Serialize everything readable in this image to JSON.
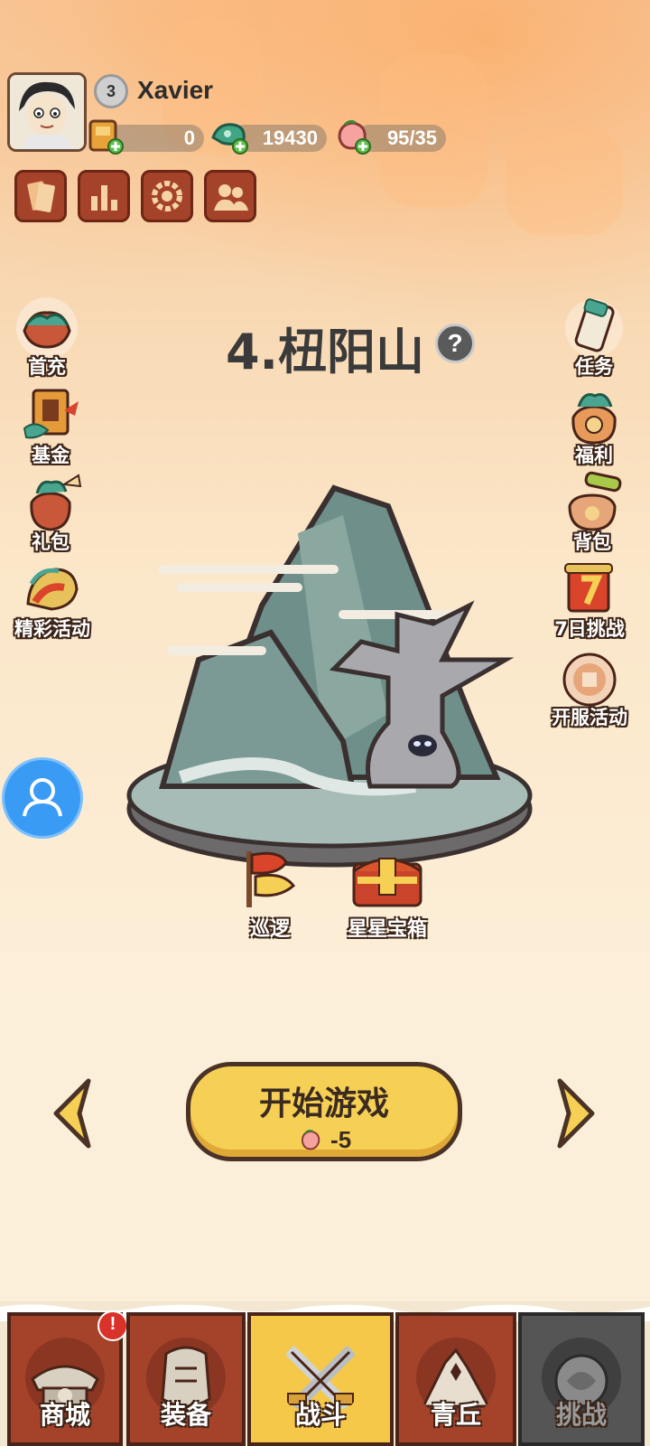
{
  "header": {
    "player_name": "Xavier",
    "level": "3",
    "resources": [
      {
        "name": "ticket",
        "value": "0"
      },
      {
        "name": "jade-coin",
        "value": "19430"
      },
      {
        "name": "peach-stamina",
        "value": "95/35"
      }
    ],
    "tools": [
      "card-icon",
      "rank-icon",
      "settings-icon",
      "friends-icon"
    ]
  },
  "stage": {
    "title": "4.杻阳山",
    "help": "?"
  },
  "left_menu": [
    {
      "label": "首充",
      "icon": "first-recharge-icon"
    },
    {
      "label": "基金",
      "icon": "fund-icon"
    },
    {
      "label": "礼包",
      "icon": "gift-bag-icon"
    },
    {
      "label": "精彩活动",
      "icon": "event-icon"
    }
  ],
  "right_menu": [
    {
      "label": "任务",
      "icon": "task-scroll-icon"
    },
    {
      "label": "福利",
      "icon": "welfare-bag-icon"
    },
    {
      "label": "背包",
      "icon": "backpack-icon"
    },
    {
      "label": "7日挑战",
      "icon": "seven-day-icon"
    },
    {
      "label": "开服活动",
      "icon": "server-event-icon"
    }
  ],
  "rewards": [
    {
      "label": "巡逻",
      "icon": "patrol-flag-icon"
    },
    {
      "label": "星星宝箱",
      "icon": "star-chest-icon"
    }
  ],
  "start": {
    "label": "开始游戏",
    "cost": "-5"
  },
  "nav": [
    {
      "label": "商城",
      "icon": "shop-icon"
    },
    {
      "label": "装备",
      "icon": "armor-icon"
    },
    {
      "label": "战斗",
      "icon": "battle-swords-icon",
      "active": true
    },
    {
      "label": "青丘",
      "icon": "qingqiu-mountain-icon"
    },
    {
      "label": "挑战",
      "icon": "challenge-icon",
      "locked": true
    }
  ],
  "badge": "!",
  "colors": {
    "button": "#f6cf55",
    "nav_active": "#f6c84a",
    "nav_bg": "#a5432a",
    "locked": "#555555"
  }
}
